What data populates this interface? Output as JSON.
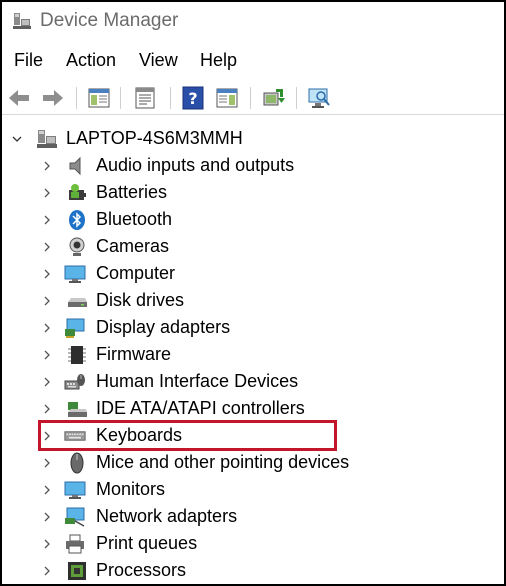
{
  "window": {
    "title": "Device Manager"
  },
  "menu": [
    "File",
    "Action",
    "View",
    "Help"
  ],
  "toolbar": {
    "buttons": [
      {
        "name": "back-arrow-icon"
      },
      {
        "name": "forward-arrow-icon"
      },
      {
        "name": "show-hide-console-tree-icon"
      },
      {
        "name": "properties-icon"
      },
      {
        "name": "help-icon"
      },
      {
        "name": "action-pane-icon"
      },
      {
        "name": "update-driver-icon"
      },
      {
        "name": "scan-hardware-changes-icon"
      }
    ]
  },
  "tree": {
    "root": {
      "label": "LAPTOP-4S6M3MMH",
      "icon": "computer-root-icon",
      "expanded": true
    },
    "items": [
      {
        "label": "Audio inputs and outputs",
        "icon": "speaker-icon"
      },
      {
        "label": "Batteries",
        "icon": "battery-icon"
      },
      {
        "label": "Bluetooth",
        "icon": "bluetooth-icon"
      },
      {
        "label": "Cameras",
        "icon": "camera-icon"
      },
      {
        "label": "Computer",
        "icon": "monitor-icon"
      },
      {
        "label": "Disk drives",
        "icon": "disk-drive-icon"
      },
      {
        "label": "Display adapters",
        "icon": "display-adapter-icon"
      },
      {
        "label": "Firmware",
        "icon": "firmware-chip-icon"
      },
      {
        "label": "Human Interface Devices",
        "icon": "hid-icon"
      },
      {
        "label": "IDE ATA/ATAPI controllers",
        "icon": "ide-controller-icon"
      },
      {
        "label": "Keyboards",
        "icon": "keyboard-icon",
        "highlighted": true
      },
      {
        "label": "Mice and other pointing devices",
        "icon": "mouse-icon"
      },
      {
        "label": "Monitors",
        "icon": "monitor-icon"
      },
      {
        "label": "Network adapters",
        "icon": "network-adapter-icon"
      },
      {
        "label": "Print queues",
        "icon": "printer-icon"
      },
      {
        "label": "Processors",
        "icon": "processor-icon"
      }
    ]
  },
  "colors": {
    "highlight": "#c4162a",
    "accent": "#1e73c8"
  }
}
